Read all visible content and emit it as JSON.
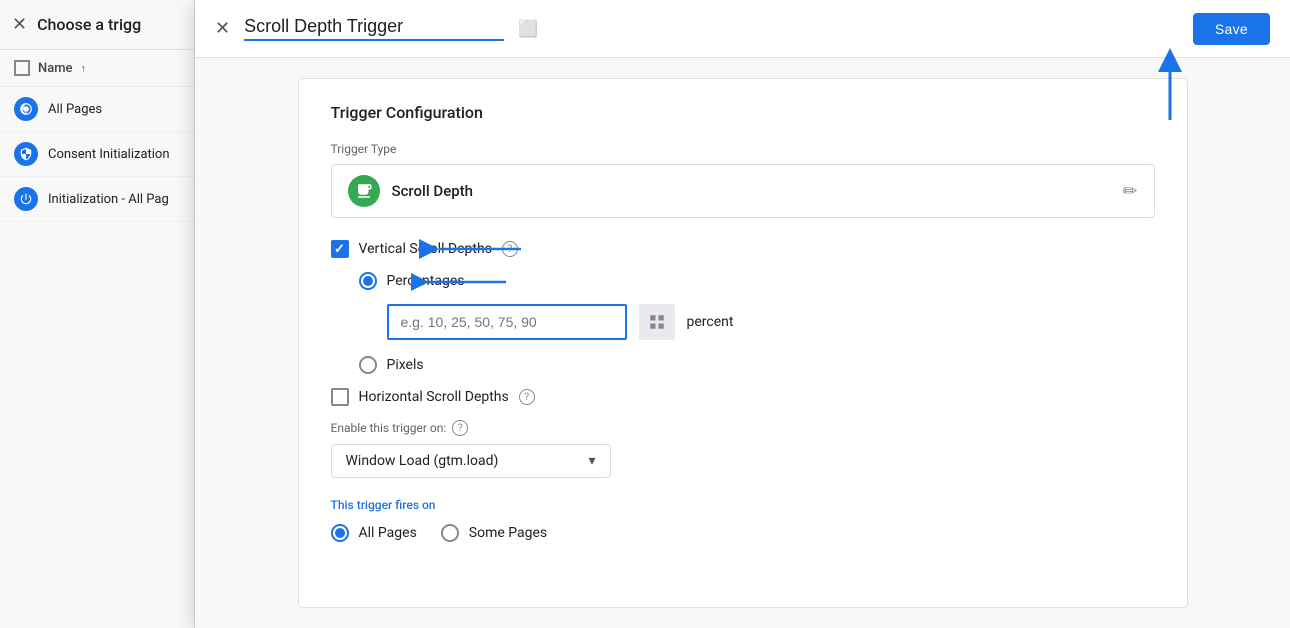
{
  "leftPanel": {
    "title": "Choose a trigg",
    "listHeader": {
      "nameLabel": "Name",
      "sortSymbol": "↑"
    },
    "items": [
      {
        "id": "all-pages",
        "label": "All Pages",
        "iconType": "eye",
        "iconColor": "blue"
      },
      {
        "id": "consent-init",
        "label": "Consent Initialization",
        "iconType": "gear",
        "iconColor": "blue"
      },
      {
        "id": "init-all",
        "label": "Initialization - All Pag",
        "iconType": "power",
        "iconColor": "blue"
      }
    ]
  },
  "modal": {
    "titlePart1": "Scroll Depth",
    "titlePart2": "Trigger",
    "saveLabel": "Save",
    "body": {
      "sectionTitle": "Trigger Configuration",
      "triggerTypeLabel": "Trigger Type",
      "triggerTypeName": "Scroll Depth",
      "verticalScrollLabel": "Vertical Scroll Depths",
      "percentagesLabel": "Percentages",
      "percentPlaceholder": "e.g. 10, 25, 50, 75, 90",
      "percentSuffix": "percent",
      "pixelsLabel": "Pixels",
      "horizontalScrollLabel": "Horizontal Scroll Depths",
      "enableLabel": "Enable this trigger on:",
      "windowLoadValue": "Window Load (gtm.load)",
      "firesOnLabel": "This trigger fires on",
      "allPagesLabel": "All Pages",
      "somePagesLabel": "Some Pages"
    }
  }
}
